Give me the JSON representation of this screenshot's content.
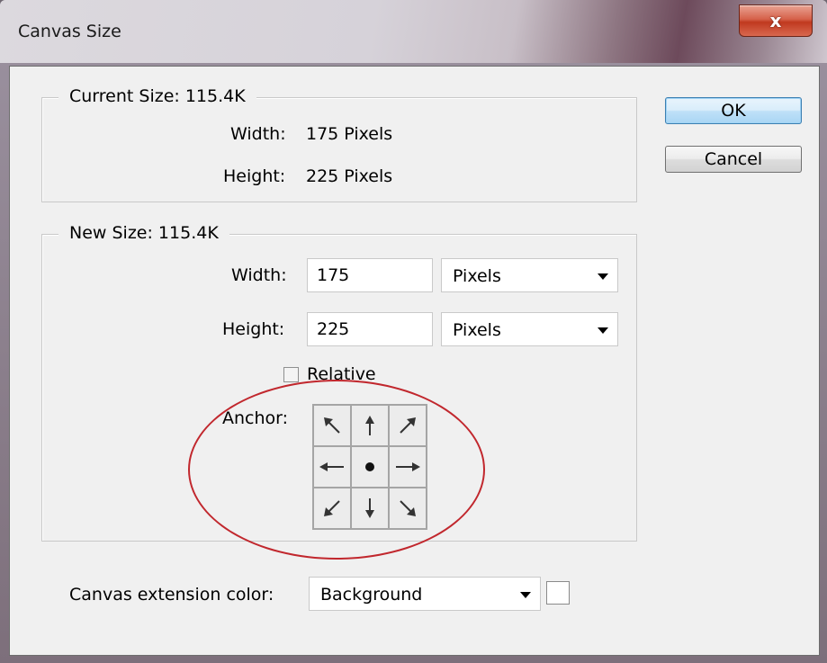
{
  "window": {
    "title": "Canvas Size",
    "close_glyph": "x"
  },
  "current_size": {
    "legend": "Current Size: 115.4K",
    "width_label": "Width:",
    "width_value": "175 Pixels",
    "height_label": "Height:",
    "height_value": "225 Pixels"
  },
  "new_size": {
    "legend": "New Size: 115.4K",
    "width_label": "Width:",
    "width_value": "175",
    "width_unit": "Pixels",
    "height_label": "Height:",
    "height_value": "225",
    "height_unit": "Pixels",
    "relative_label": "Relative",
    "relative_checked": false,
    "anchor_label": "Anchor:",
    "anchor_cells": [
      "arrow-up-left-icon",
      "arrow-up-icon",
      "arrow-up-right-icon",
      "arrow-left-icon",
      "anchor-center-dot-icon",
      "arrow-right-icon",
      "arrow-down-left-icon",
      "arrow-down-icon",
      "arrow-down-right-icon"
    ]
  },
  "extension": {
    "label": "Canvas extension color:",
    "value": "Background",
    "swatch_color": "#ffffff"
  },
  "buttons": {
    "ok": "OK",
    "cancel": "Cancel"
  },
  "highlight": {
    "color": "#c1272d"
  }
}
